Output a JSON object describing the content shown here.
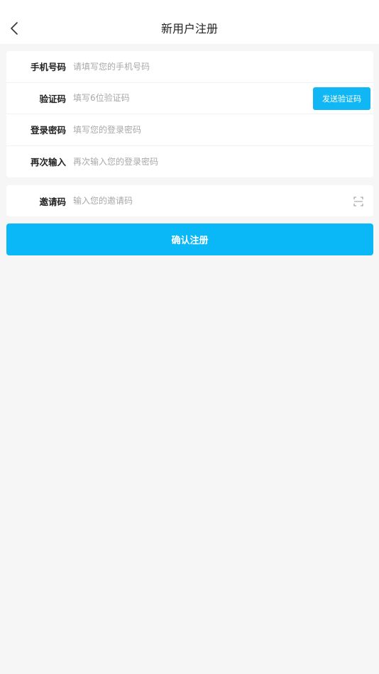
{
  "header": {
    "title": "新用户注册",
    "back_icon": "chevron-left-icon"
  },
  "form": {
    "phone": {
      "label": "手机号码",
      "placeholder": "请填写您的手机号码",
      "value": ""
    },
    "code": {
      "label": "验证码",
      "placeholder": "填写6位验证码",
      "value": "",
      "send_button_label": "发送验证码"
    },
    "password": {
      "label": "登录密码",
      "placeholder": "填写您的登录密码",
      "value": ""
    },
    "password_confirm": {
      "label": "再次输入",
      "placeholder": "再次输入您的登录密码",
      "value": ""
    }
  },
  "invite": {
    "label": "邀请码",
    "placeholder": "输入您的邀请码",
    "value": "",
    "scan_icon": "scan-icon"
  },
  "submit": {
    "label": "确认注册"
  },
  "colors": {
    "accent": "#0ab8f8",
    "background": "#f6f6f6",
    "card": "#ffffff",
    "label_text": "#222222",
    "placeholder_text": "#a8a8a8"
  }
}
